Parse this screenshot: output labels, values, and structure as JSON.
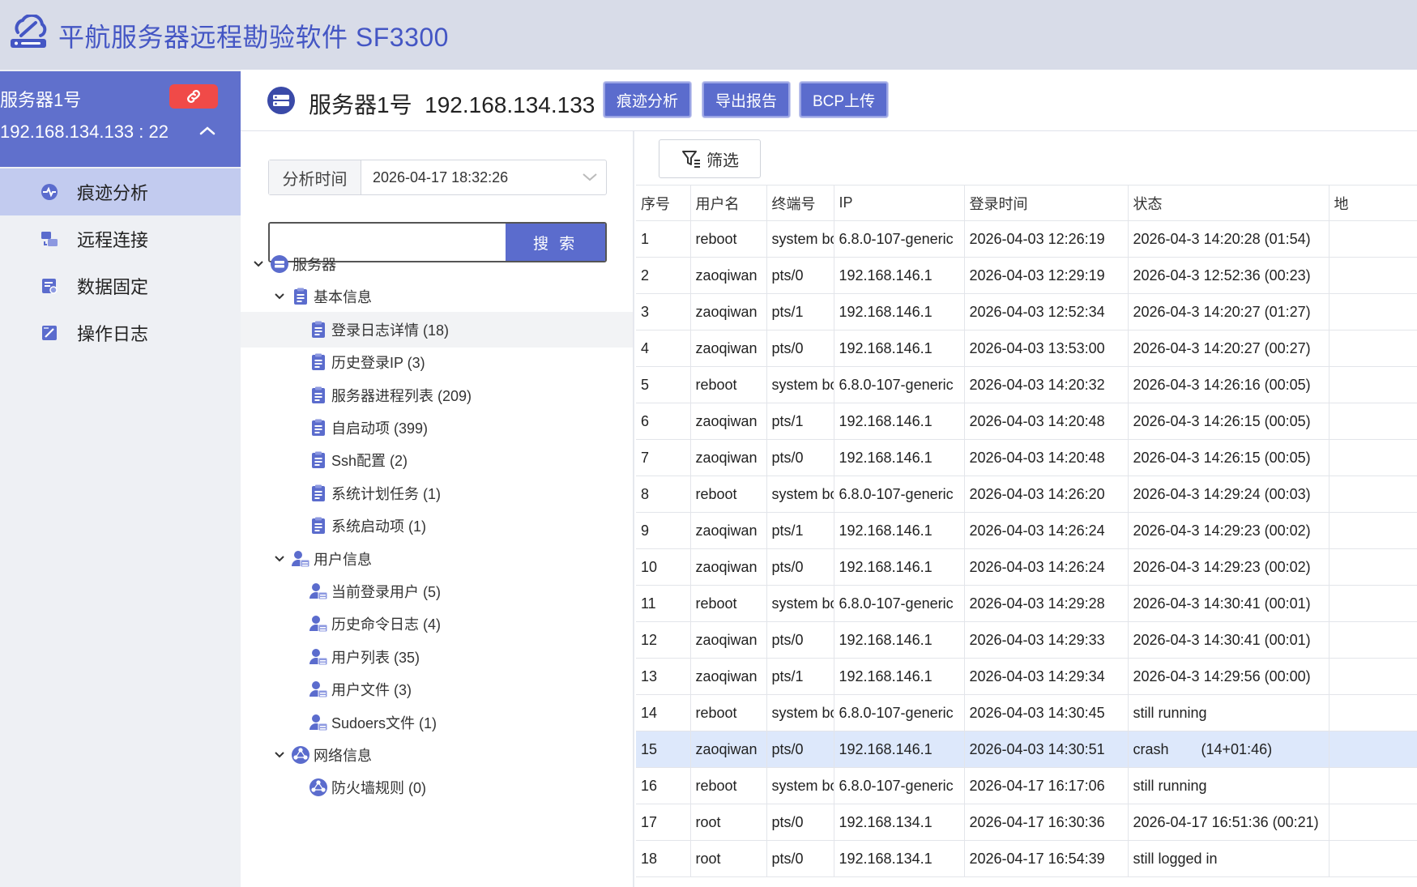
{
  "app": {
    "title": "平航服务器远程勘验软件 SF3300",
    "logo_icon": "cloud-server-logo-icon",
    "accent_color": "#5b6ccd"
  },
  "server": {
    "name": "服务器1号",
    "address": "192.168.134.133 : 22",
    "link_icon": "link-icon",
    "collapse_icon": "chevron-up-icon"
  },
  "nav": {
    "items": [
      {
        "label": "痕迹分析",
        "icon": "trace-analysis-icon",
        "active": true
      },
      {
        "label": "远程连接",
        "icon": "remote-connect-icon",
        "active": false
      },
      {
        "label": "数据固定",
        "icon": "data-fix-icon",
        "active": false
      },
      {
        "label": "操作日志",
        "icon": "operation-log-icon",
        "active": false
      }
    ]
  },
  "header": {
    "server_icon": "server-icon",
    "title": "服务器1号  192.168.134.133",
    "buttons": [
      "痕迹分析",
      "导出报告",
      "BCP上传"
    ]
  },
  "tree": {
    "time_label": "分析时间",
    "time_value": "2026-04-17 18:32:26",
    "search_value": "",
    "search_button": "搜 索",
    "nodes": [
      {
        "label": "服务器",
        "level": 0,
        "expanded": true,
        "icon": "server-icon"
      },
      {
        "label": "基本信息",
        "level": 1,
        "expanded": true,
        "icon": "clipboard-icon"
      },
      {
        "label": "登录日志详情 (18)",
        "level": 2,
        "icon": "clipboard-icon",
        "selected": true
      },
      {
        "label": "历史登录IP (3)",
        "level": 2,
        "icon": "clipboard-icon"
      },
      {
        "label": "服务器进程列表 (209)",
        "level": 2,
        "icon": "clipboard-icon"
      },
      {
        "label": "自启动项 (399)",
        "level": 2,
        "icon": "clipboard-icon"
      },
      {
        "label": "Ssh配置 (2)",
        "level": 2,
        "icon": "clipboard-icon"
      },
      {
        "label": "系统计划任务 (1)",
        "level": 2,
        "icon": "clipboard-icon"
      },
      {
        "label": "系统启动项 (1)",
        "level": 2,
        "icon": "clipboard-icon"
      },
      {
        "label": "用户信息",
        "level": 1,
        "expanded": true,
        "icon": "user-card-icon"
      },
      {
        "label": "当前登录用户 (5)",
        "level": 2,
        "icon": "user-card-icon"
      },
      {
        "label": "历史命令日志 (4)",
        "level": 2,
        "icon": "user-card-icon"
      },
      {
        "label": "用户列表 (35)",
        "level": 2,
        "icon": "user-card-icon"
      },
      {
        "label": "用户文件 (3)",
        "level": 2,
        "icon": "user-card-icon"
      },
      {
        "label": "Sudoers文件 (1)",
        "level": 2,
        "icon": "user-card-icon"
      },
      {
        "label": "网络信息",
        "level": 1,
        "expanded": true,
        "icon": "network-icon"
      },
      {
        "label": "防火墙规则 (0)",
        "level": 2,
        "icon": "network-icon"
      }
    ]
  },
  "table": {
    "filter_label": "筛选",
    "filter_icon": "filter-icon",
    "columns": [
      "序号",
      "用户名",
      "终端号",
      "IP",
      "登录时间",
      "状态",
      "地"
    ],
    "highlight_row": 15,
    "rows": [
      [
        "1",
        "reboot",
        "system boot",
        "6.8.0-107-generic",
        "2026-04-03 12:26:19",
        "2026-04-3 14:20:28 (01:54)"
      ],
      [
        "2",
        "zaoqiwan",
        "pts/0",
        "192.168.146.1",
        "2026-04-03 12:29:19",
        "2026-04-3 12:52:36 (00:23)"
      ],
      [
        "3",
        "zaoqiwan",
        "pts/1",
        "192.168.146.1",
        "2026-04-03 12:52:34",
        "2026-04-3 14:20:27 (01:27)"
      ],
      [
        "4",
        "zaoqiwan",
        "pts/0",
        "192.168.146.1",
        "2026-04-03 13:53:00",
        "2026-04-3 14:20:27 (00:27)"
      ],
      [
        "5",
        "reboot",
        "system boot",
        "6.8.0-107-generic",
        "2026-04-03 14:20:32",
        "2026-04-3 14:26:16 (00:05)"
      ],
      [
        "6",
        "zaoqiwan",
        "pts/1",
        "192.168.146.1",
        "2026-04-03 14:20:48",
        "2026-04-3 14:26:15 (00:05)"
      ],
      [
        "7",
        "zaoqiwan",
        "pts/0",
        "192.168.146.1",
        "2026-04-03 14:20:48",
        "2026-04-3 14:26:15 (00:05)"
      ],
      [
        "8",
        "reboot",
        "system boot",
        "6.8.0-107-generic",
        "2026-04-03 14:26:20",
        "2026-04-3 14:29:24 (00:03)"
      ],
      [
        "9",
        "zaoqiwan",
        "pts/1",
        "192.168.146.1",
        "2026-04-03 14:26:24",
        "2026-04-3 14:29:23 (00:02)"
      ],
      [
        "10",
        "zaoqiwan",
        "pts/0",
        "192.168.146.1",
        "2026-04-03 14:26:24",
        "2026-04-3 14:29:23 (00:02)"
      ],
      [
        "11",
        "reboot",
        "system boot",
        "6.8.0-107-generic",
        "2026-04-03 14:29:28",
        "2026-04-3 14:30:41 (00:01)"
      ],
      [
        "12",
        "zaoqiwan",
        "pts/0",
        "192.168.146.1",
        "2026-04-03 14:29:33",
        "2026-04-3 14:30:41 (00:01)"
      ],
      [
        "13",
        "zaoqiwan",
        "pts/1",
        "192.168.146.1",
        "2026-04-03 14:29:34",
        "2026-04-3 14:29:56 (00:00)"
      ],
      [
        "14",
        "reboot",
        "system boot",
        "6.8.0-107-generic",
        "2026-04-03 14:30:45",
        "still running"
      ],
      [
        "15",
        "zaoqiwan",
        "pts/0",
        "192.168.146.1",
        "2026-04-03 14:30:51",
        "crash        (14+01:46)"
      ],
      [
        "16",
        "reboot",
        "system boot",
        "6.8.0-107-generic",
        "2026-04-17 16:17:06",
        "still running"
      ],
      [
        "17",
        "root",
        "pts/0",
        "192.168.134.1",
        "2026-04-17 16:30:36",
        "2026-04-17 16:51:36 (00:21)"
      ],
      [
        "18",
        "root",
        "pts/0",
        "192.168.134.1",
        "2026-04-17 16:54:39",
        "still logged in"
      ]
    ]
  }
}
